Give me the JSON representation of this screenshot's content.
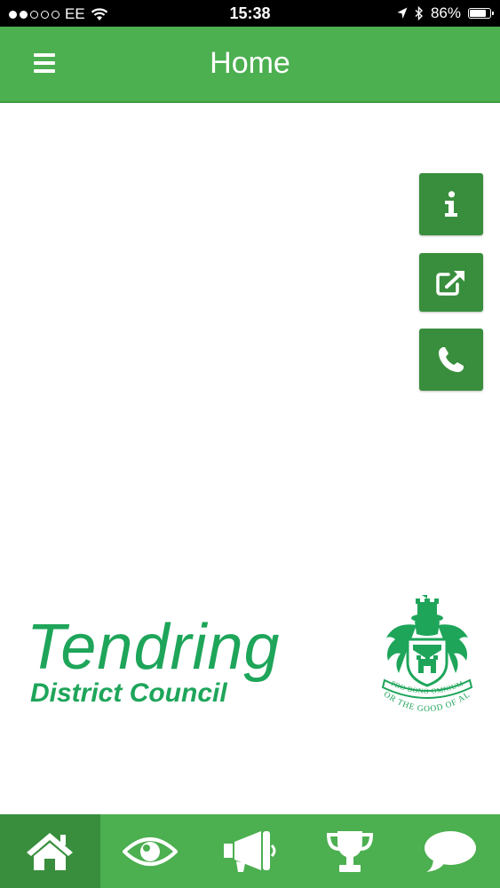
{
  "status_bar": {
    "carrier": "EE",
    "time": "15:38",
    "battery": "86%",
    "battery_level": 0.86,
    "signal_bars_filled": 2,
    "signal_bars_total": 5,
    "icons": [
      "wifi-icon",
      "location-arrow-icon",
      "bluetooth-icon",
      "battery-icon"
    ]
  },
  "header": {
    "title": "Home",
    "menu_icon": "hamburger-menu-icon"
  },
  "side_actions": [
    {
      "icon": "info-icon"
    },
    {
      "icon": "external-link-icon"
    },
    {
      "icon": "phone-icon"
    }
  ],
  "logo": {
    "name": "Tendring",
    "subtitle": "District Council",
    "crest_motto": "PRO BONO OMNIUM",
    "crest_tagline": "FOR THE GOOD OF ALL"
  },
  "tabs": [
    {
      "icon": "home-icon",
      "active": true
    },
    {
      "icon": "eye-icon",
      "active": false
    },
    {
      "icon": "megaphone-icon",
      "active": false
    },
    {
      "icon": "trophy-icon",
      "active": false
    },
    {
      "icon": "speech-bubble-icon",
      "active": false
    }
  ],
  "colors": {
    "header_green": "#4caf50",
    "dark_green": "#388e3c",
    "logo_green": "#1ea55a",
    "status_bar": "#000000"
  }
}
